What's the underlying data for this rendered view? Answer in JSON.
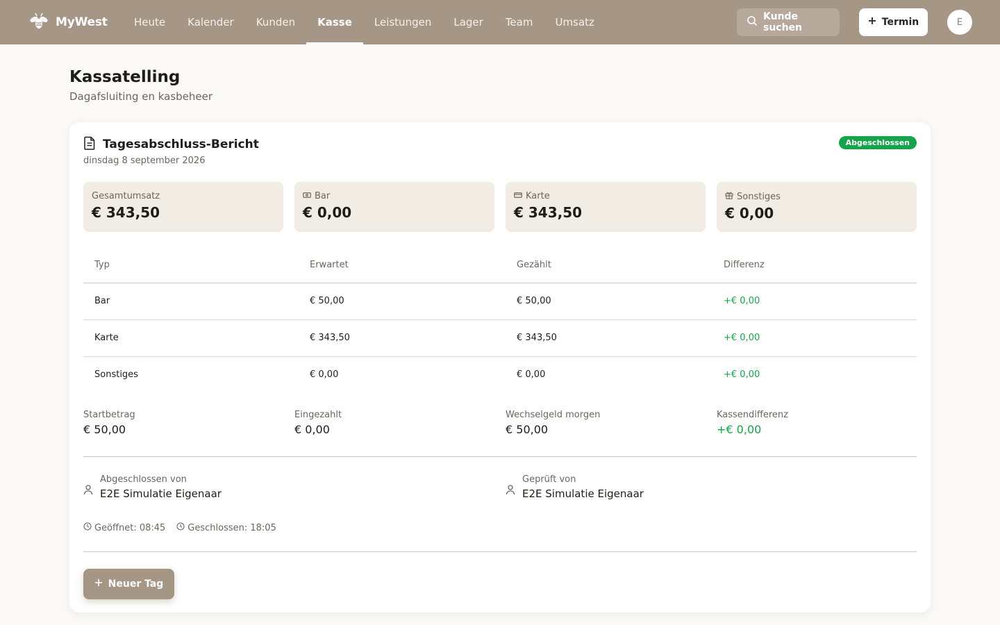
{
  "app": {
    "brand": "MyWest",
    "nav": [
      {
        "label": "Heute"
      },
      {
        "label": "Kalender"
      },
      {
        "label": "Kunden"
      },
      {
        "label": "Kasse",
        "active": true
      },
      {
        "label": "Leistungen"
      },
      {
        "label": "Lager"
      },
      {
        "label": "Team"
      },
      {
        "label": "Umsatz"
      }
    ],
    "search_label": "Kunde suchen",
    "termin_label": "Termin",
    "avatar_initial": "E"
  },
  "page": {
    "title": "Kassatelling",
    "subtitle": "Dagafsluiting en kasbeheer"
  },
  "report": {
    "title": "Tagesabschluss-Bericht",
    "date": "dinsdag 8 september 2026",
    "status": "Abgeschlossen",
    "status_color": "#16a34a",
    "stats": [
      {
        "label": "Gesamtumsatz",
        "value": "€ 343,50",
        "icon": ""
      },
      {
        "label": "Bar",
        "value": "€ 0,00",
        "icon": "cash-icon"
      },
      {
        "label": "Karte",
        "value": "€ 343,50",
        "icon": "card-icon"
      },
      {
        "label": "Sonstiges",
        "value": "€ 0,00",
        "icon": "gift-icon"
      }
    ],
    "table": {
      "headers": [
        "Typ",
        "Erwartet",
        "Gezählt",
        "Differenz"
      ],
      "rows": [
        [
          "Bar",
          "€ 50,00",
          "€ 50,00",
          "+€ 0,00"
        ],
        [
          "Karte",
          "€ 343,50",
          "€ 343,50",
          "+€ 0,00"
        ],
        [
          "Sonstiges",
          "€ 0,00",
          "€ 0,00",
          "+€ 0,00"
        ]
      ]
    },
    "summary": [
      {
        "label": "Startbetrag",
        "value": "€ 50,00"
      },
      {
        "label": "Eingezahlt",
        "value": "€ 0,00"
      },
      {
        "label": "Wechselgeld morgen",
        "value": "€ 50,00"
      },
      {
        "label": "Kassendifferenz",
        "value": "+€ 0,00"
      }
    ],
    "closed_by": {
      "label": "Abgeschlossen von",
      "name": "E2E Simulatie Eigenaar"
    },
    "checked_by": {
      "label": "Geprüft von",
      "name": "E2E Simulatie Eigenaar"
    },
    "opened": "Geöffnet: 08:45",
    "closed": "Geschlossen: 18:05",
    "new_day_label": "Neuer Tag"
  },
  "colors": {
    "topbar": "#a69686",
    "positive": "#16a34a",
    "stat_bg": "#f1ece4"
  }
}
